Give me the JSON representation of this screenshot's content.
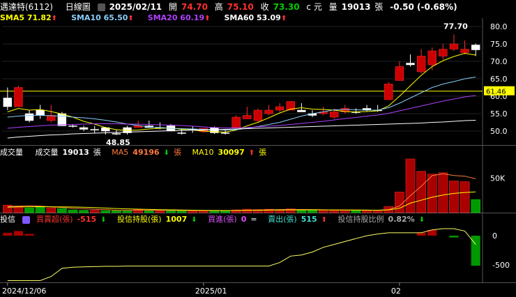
{
  "header": {
    "name": "邁達特(6112)",
    "period": "日線圖",
    "date": "2025/02/11",
    "open_label": "開",
    "open": "74.70",
    "high_label": "高",
    "high": "75.10",
    "close_label": "收",
    "close": "73.30",
    "currency": "c 元",
    "volume_label": "量",
    "volume": "19013",
    "volume_unit": "張",
    "change": "-0.50 (-0.68%)"
  },
  "ma_legend": [
    {
      "label": "SMA5",
      "value": "71.82",
      "color": "#ffff00",
      "dir": "up"
    },
    {
      "label": "SMA10",
      "value": "65.50",
      "color": "#87cefa",
      "dir": "up"
    },
    {
      "label": "SMA20",
      "value": "60.19",
      "color": "#b040ff",
      "dir": "up"
    },
    {
      "label": "SMA60",
      "value": "53.09",
      "color": "#ffffff",
      "dir": "up"
    }
  ],
  "vol_legend": {
    "title": "成交量",
    "vol_label": "成交量",
    "vol_value": "19013",
    "vol_unit": "張",
    "ma5_label": "MA5",
    "ma5_value": "49196",
    "ma5_dir": "down",
    "ma5_unit": "張",
    "ma10_label": "MA10",
    "ma10_value": "30097",
    "ma10_dir": "up",
    "ma10_unit": "張"
  },
  "inst_legend": {
    "title": "投信",
    "net_label": "買賣超(張)",
    "net_value": "-515",
    "net_dir": "down",
    "hold_label": "投信持股(張)",
    "hold_value": "1007",
    "hold_dir": "down",
    "buy_label": "買進(張)",
    "buy_value": "0",
    "buy_sym": "=",
    "sell_label": "賣出(張)",
    "sell_value": "515",
    "sell_dir": "up",
    "ratio_label": "投信持股比例",
    "ratio_value": "0.82%",
    "ratio_dir": "down"
  },
  "colors": {
    "up": "#ff3030",
    "down": "#00d000",
    "flat": "#ffffff",
    "ref": "#ffff00"
  },
  "chart_data": [
    {
      "type": "candlestick",
      "ylim": [
        46,
        82
      ],
      "yticks": [
        "80.0",
        "75.0",
        "70.0",
        "65.0",
        "60.0",
        "55.0",
        "50.0"
      ],
      "ref_line": "61.46",
      "annotations": [
        {
          "text": "77.70",
          "index": 41
        },
        {
          "text": "48.85",
          "index": 10
        }
      ],
      "x_labels": [
        {
          "text": "2024/12/06",
          "index": 0
        },
        {
          "text": "2025/01",
          "index": 18
        },
        {
          "text": "02",
          "index": 36
        }
      ],
      "ohlc": [
        [
          59.5,
          62.5,
          56.0,
          57.0
        ],
        [
          57.0,
          63.0,
          57.0,
          62.5
        ],
        [
          55.0,
          56.0,
          52.5,
          53.0
        ],
        [
          56.0,
          57.5,
          53.5,
          54.5
        ],
        [
          53.0,
          57.5,
          52.5,
          54.5
        ],
        [
          55.0,
          55.5,
          51.5,
          51.5
        ],
        [
          51.5,
          52.0,
          51.0,
          51.5
        ],
        [
          51.0,
          51.5,
          50.0,
          50.5
        ],
        [
          50.5,
          51.5,
          49.5,
          50.5
        ],
        [
          51.0,
          51.2,
          49.0,
          50.0
        ],
        [
          49.3,
          50.5,
          48.85,
          49.3
        ],
        [
          51.0,
          51.5,
          49.0,
          49.5
        ],
        [
          51.0,
          53.0,
          51.0,
          51.5
        ],
        [
          51.5,
          53.0,
          51.0,
          51.0
        ],
        [
          51.0,
          52.5,
          50.5,
          51.0
        ],
        [
          51.5,
          52.0,
          50.0,
          50.0
        ],
        [
          49.5,
          50.5,
          49.0,
          49.5
        ],
        [
          50.5,
          51.5,
          49.5,
          50.5
        ],
        [
          49.8,
          50.8,
          49.5,
          50.8
        ],
        [
          51.0,
          51.3,
          49.2,
          49.5
        ],
        [
          49.5,
          50.5,
          49.0,
          49.5
        ],
        [
          51.0,
          54.5,
          51.0,
          54.0
        ],
        [
          53.5,
          57.0,
          53.5,
          54.5
        ],
        [
          53.0,
          56.5,
          52.5,
          56.0
        ],
        [
          55.0,
          57.5,
          54.5,
          56.0
        ],
        [
          56.0,
          58.0,
          55.5,
          57.0
        ],
        [
          56.0,
          58.5,
          56.0,
          58.5
        ],
        [
          56.0,
          58.0,
          55.5,
          55.5
        ],
        [
          55.0,
          56.0,
          54.0,
          54.5
        ],
        [
          55.0,
          57.0,
          54.5,
          55.5
        ],
        [
          54.0,
          56.5,
          53.5,
          55.5
        ],
        [
          55.5,
          57.5,
          55.0,
          56.5
        ],
        [
          55.5,
          56.5,
          55.0,
          55.5
        ],
        [
          56.5,
          57.5,
          55.5,
          56.0
        ],
        [
          56.0,
          57.5,
          55.5,
          56.0
        ],
        [
          59.0,
          64.0,
          59.0,
          63.5
        ],
        [
          64.5,
          70.0,
          64.5,
          68.5
        ],
        [
          69.5,
          72.0,
          68.5,
          69.0
        ],
        [
          67.0,
          73.5,
          66.5,
          71.5
        ],
        [
          69.0,
          74.0,
          67.5,
          73.0
        ],
        [
          71.5,
          75.0,
          70.5,
          73.5
        ],
        [
          73.5,
          77.7,
          73.0,
          75.0
        ],
        [
          72.5,
          76.0,
          72.0,
          73.5
        ],
        [
          74.7,
          75.1,
          71.5,
          73.3
        ]
      ],
      "series": [
        {
          "name": "SMA5",
          "values": [
            55.5,
            56.5,
            56.0,
            56.2,
            55.6,
            54.9,
            54.0,
            52.8,
            52.0,
            51.0,
            50.4,
            50.2,
            50.3,
            50.6,
            50.8,
            50.9,
            50.5,
            50.3,
            50.0,
            49.8,
            49.7,
            50.3,
            51.5,
            52.5,
            53.8,
            55.2,
            56.3,
            56.7,
            56.3,
            56.2,
            56.0,
            55.6,
            55.5,
            55.6,
            55.8,
            57.2,
            60.0,
            63.0,
            66.0,
            68.5,
            70.2,
            71.4,
            72.3,
            71.8
          ]
        },
        {
          "name": "SMA10",
          "values": [
            54.0,
            54.3,
            54.5,
            54.5,
            54.4,
            54.3,
            54.0,
            53.8,
            53.5,
            53.1,
            52.6,
            52.0,
            51.6,
            51.2,
            51.0,
            50.8,
            50.7,
            50.6,
            50.5,
            50.4,
            50.3,
            50.4,
            50.8,
            51.3,
            51.9,
            52.5,
            53.4,
            54.3,
            55.0,
            55.5,
            56.1,
            56.2,
            56.1,
            56.0,
            56.0,
            56.7,
            58.0,
            59.5,
            61.0,
            62.5,
            63.5,
            64.2,
            65.0,
            65.5
          ]
        },
        {
          "name": "SMA20",
          "values": [
            50.8,
            51.1,
            51.3,
            51.5,
            51.7,
            51.8,
            51.9,
            52.0,
            52.1,
            52.1,
            52.1,
            52.0,
            52.0,
            51.9,
            51.8,
            51.7,
            51.6,
            51.4,
            51.2,
            51.0,
            50.9,
            50.9,
            51.0,
            51.2,
            51.4,
            51.6,
            51.9,
            52.2,
            52.5,
            52.8,
            53.2,
            53.6,
            53.9,
            54.3,
            54.6,
            55.1,
            55.8,
            56.5,
            57.2,
            57.9,
            58.6,
            59.2,
            59.8,
            60.2
          ]
        },
        {
          "name": "SMA60",
          "values": [
            48.0,
            48.3,
            48.5,
            48.7,
            48.9,
            49.0,
            49.2,
            49.3,
            49.4,
            49.5,
            49.6,
            49.7,
            49.8,
            49.9,
            50.0,
            50.1,
            50.2,
            50.3,
            50.3,
            50.4,
            50.5,
            50.6,
            50.7,
            50.8,
            50.9,
            51.0,
            51.1,
            51.2,
            51.3,
            51.4,
            51.5,
            51.6,
            51.7,
            51.8,
            51.9,
            52.0,
            52.1,
            52.2,
            52.3,
            52.5,
            52.6,
            52.8,
            53.0,
            53.1
          ]
        }
      ]
    },
    {
      "type": "bar",
      "ylim": [
        0,
        80000
      ],
      "yticks": [
        "50K"
      ],
      "values": [
        11000,
        9000,
        7000,
        8000,
        7000,
        6000,
        4000,
        3500,
        3500,
        3000,
        3000,
        3000,
        4500,
        3000,
        3000,
        3000,
        2500,
        3000,
        3000,
        3000,
        2500,
        4000,
        5000,
        4500,
        5000,
        3500,
        5500,
        4000,
        3500,
        4000,
        3000,
        4000,
        3500,
        3000,
        3000,
        9000,
        30000,
        78000,
        60000,
        56000,
        58000,
        46000,
        45000,
        19013
      ],
      "up": [
        true,
        true,
        false,
        false,
        true,
        false,
        false,
        false,
        true,
        false,
        false,
        false,
        true,
        false,
        true,
        false,
        false,
        true,
        true,
        false,
        false,
        true,
        true,
        true,
        true,
        true,
        true,
        false,
        false,
        true,
        true,
        true,
        false,
        true,
        true,
        true,
        true,
        true,
        true,
        true,
        true,
        true,
        true,
        false
      ],
      "series": [
        {
          "name": "MA5",
          "values": [
            9000,
            9500,
            10000,
            9500,
            8500,
            7500,
            6500,
            5800,
            5000,
            4500,
            3500,
            3300,
            3400,
            3400,
            3300,
            3300,
            3100,
            3000,
            2900,
            2900,
            2800,
            3100,
            3500,
            3800,
            4200,
            4500,
            4700,
            4600,
            4500,
            4200,
            3900,
            3800,
            3700,
            3600,
            3400,
            4500,
            9600,
            24600,
            38400,
            53800,
            56400,
            54000,
            53000,
            49196
          ]
        },
        {
          "name": "MA10",
          "values": [
            8000,
            8300,
            8500,
            8600,
            8500,
            8400,
            8200,
            7900,
            7300,
            6700,
            6000,
            5500,
            5100,
            4700,
            4400,
            4100,
            3800,
            3500,
            3300,
            3100,
            3000,
            3000,
            3200,
            3400,
            3600,
            3800,
            3900,
            4000,
            4100,
            4000,
            3900,
            3800,
            3700,
            3600,
            3500,
            4000,
            6400,
            13800,
            18000,
            22400,
            25600,
            27900,
            29300,
            30097
          ]
        }
      ]
    },
    {
      "type": "bar",
      "ylim": [
        -800,
        180
      ],
      "yticks": [
        "0",
        "-500"
      ],
      "values": [
        50,
        80,
        30,
        0,
        0,
        0,
        0,
        0,
        0,
        0,
        0,
        0,
        0,
        0,
        0,
        0,
        0,
        0,
        0,
        0,
        0,
        0,
        0,
        0,
        0,
        0,
        0,
        0,
        0,
        0,
        0,
        0,
        0,
        0,
        0,
        0,
        0,
        0,
        50,
        100,
        0,
        -30,
        0,
        -515
      ],
      "series": [
        {
          "name": "投信持股",
          "values": [
            -770,
            -770,
            -770,
            -770,
            -700,
            -560,
            -540,
            -535,
            -530,
            -525,
            -525,
            -520,
            -520,
            -520,
            -520,
            -520,
            -520,
            -520,
            -520,
            -520,
            -520,
            -520,
            -520,
            -520,
            -520,
            -460,
            -350,
            -330,
            -280,
            -200,
            -150,
            -100,
            -50,
            0,
            30,
            50,
            50,
            50,
            50,
            100,
            120,
            120,
            80,
            -150
          ]
        }
      ]
    }
  ]
}
